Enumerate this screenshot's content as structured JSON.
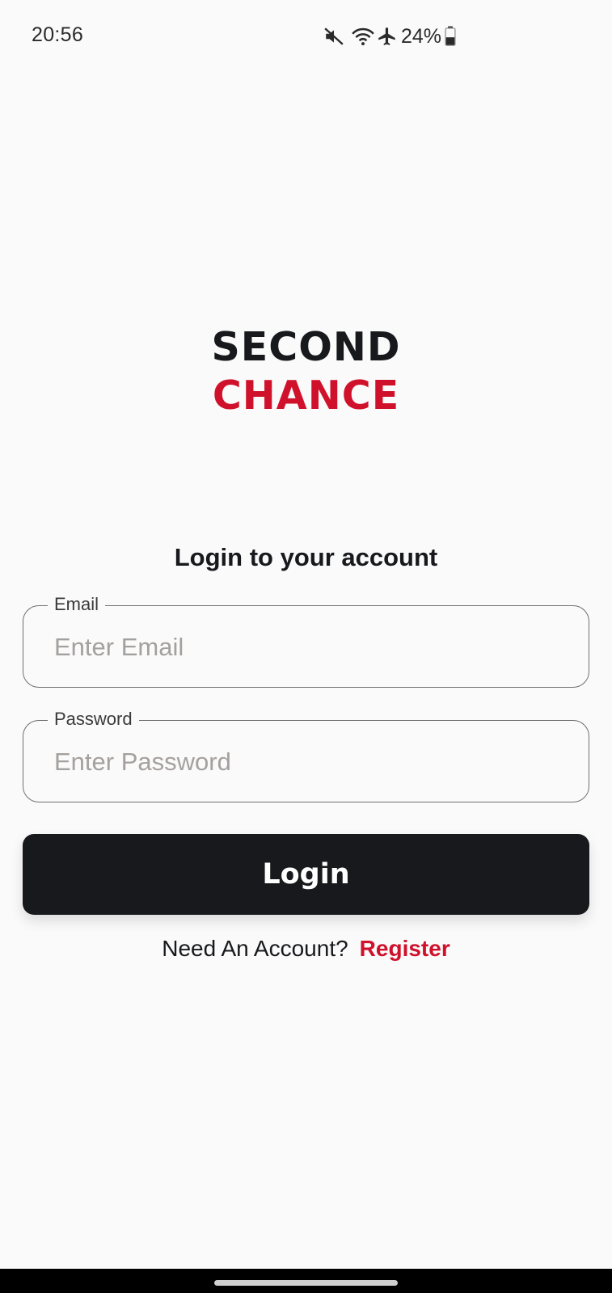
{
  "status_bar": {
    "time": "20:56",
    "battery": "24%",
    "icons": [
      "mute-icon",
      "wifi-icon",
      "airplane-icon",
      "battery-icon"
    ]
  },
  "logo": {
    "line1": "SECOND",
    "line2": "CHANCE",
    "colors": {
      "line1": "#17191c",
      "line2": "#d0112b"
    }
  },
  "form": {
    "heading": "Login to your account",
    "email": {
      "label": "Email",
      "placeholder": "Enter Email",
      "value": ""
    },
    "password": {
      "label": "Password",
      "placeholder": "Enter Password",
      "value": ""
    },
    "login_label": "Login"
  },
  "register": {
    "prompt": "Need An Account?",
    "link_label": "Register"
  },
  "colors": {
    "accent": "#d0112b",
    "dark": "#17191c",
    "background": "#fafafa"
  }
}
